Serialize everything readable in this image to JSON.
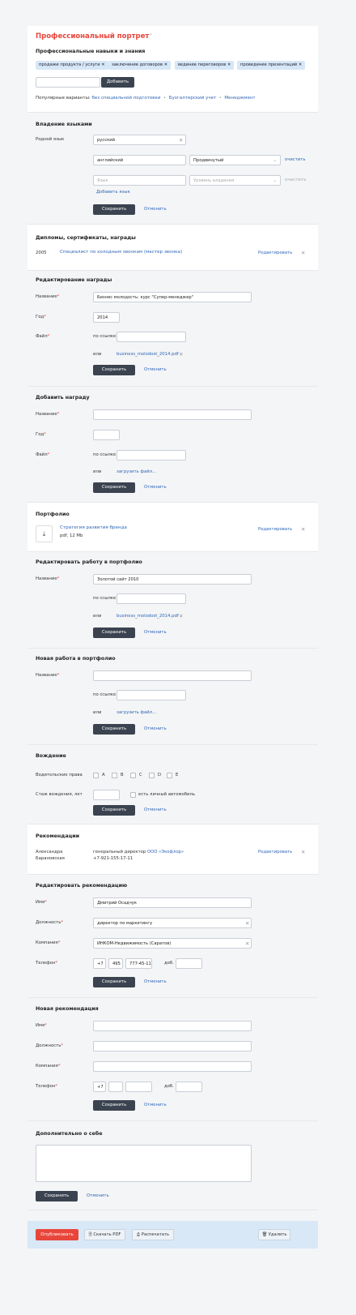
{
  "header": {
    "title": "Профессиональный портрет",
    "collapse_icon": "chevron-up-icon"
  },
  "skills": {
    "heading": "Профессиональные навыки и знания",
    "tags": [
      "продажи продукта / услуги",
      "заключение договоров",
      "ведение переговоров",
      "проведение презентаций"
    ],
    "add_button": "Добавить",
    "popular_label": "Популярные варианты:",
    "popular": [
      "без специальной подготовки",
      "Бухгалтерский учет",
      "Менеджмент"
    ]
  },
  "languages": {
    "heading": "Владение языками",
    "native_label": "Родной язык",
    "native_value": "русский",
    "lang2_value": "английский",
    "lang2_level": "Продвинутый",
    "clear": "очистить",
    "lang_placeholder": "Язык",
    "level_placeholder": "Уровень владения",
    "add_link": "Добавить язык",
    "save": "Сохранить",
    "cancel": "Отменить"
  },
  "diplomas": {
    "heading": "Диплом­ы, сертификаты, награды",
    "year": "2005",
    "title": "Специалист по холодным звонкам (мастер звонка)",
    "edit": "Редактировать"
  },
  "edit_award": {
    "heading": "Редактирование награды",
    "name_label": "Название",
    "name_value": "Бизнес молодость: курс \"Супер-менеджер\"",
    "year_label": "Год",
    "year_value": "2014",
    "file_label": "Файл",
    "by_link": "по ссылке",
    "or": "или",
    "file_name": "business_molodost_2014.pdf",
    "save": "Сохранить",
    "cancel": "Отменить"
  },
  "add_award": {
    "heading": "Добавить награду",
    "name_label": "Название",
    "year_label": "Год",
    "file_label": "Файл",
    "by_link": "по ссылке",
    "or": "или",
    "upload": "загрузить файл...",
    "save": "Сохранить",
    "cancel": "Отменить"
  },
  "portfolio": {
    "heading": "Портфолио",
    "item_title": "Стратегия развития бренда",
    "item_meta": "pdf, 12 Mb",
    "edit": "Редактировать"
  },
  "edit_portfolio": {
    "heading": "Редактировать работу в портфолио",
    "name_label": "Название",
    "name_value": "Золотой сайт 2010",
    "by_link": "по ссылке",
    "or": "или",
    "file_name": "business_molodost_2014.pdf",
    "save": "Сохранить",
    "cancel": "Отменить"
  },
  "new_portfolio": {
    "heading": "Новая работа в портфолио",
    "name_label": "Название",
    "by_link": "по ссылке",
    "or": "или",
    "upload": "загрузить файл...",
    "save": "Сохранить",
    "cancel": "Отменить"
  },
  "driving": {
    "heading": "Вождение",
    "license_label": "Водительские права",
    "categories": [
      "A",
      "B",
      "C",
      "D",
      "E"
    ],
    "exp_label": "Стаж вождения, лет",
    "own_car": "есть личный автомобиль",
    "save": "Сохранить",
    "cancel": "Отменить"
  },
  "recommendations": {
    "heading": "Рекомендации",
    "name_line1": "Александра",
    "name_line2": "Барановская",
    "position": "генеральный директор",
    "company": "ООО «Экофлор»",
    "phone": "+7-921-155-17-11",
    "edit": "Редактировать"
  },
  "edit_rec": {
    "heading": "Редактировать рекомендацию",
    "name_label": "Имя",
    "name_value": "Дмитрий Осадчук",
    "pos_label": "Должность",
    "pos_value": "директор по маркетингу",
    "company_label": "Компания",
    "company_value": "ИНКОМ-Недвижимость (Саратов)",
    "phone_label": "Телефон",
    "phone_code": "+7",
    "phone_area": "495",
    "phone_num": "777-45-11",
    "ext_label": "доб.",
    "save": "Сохранить",
    "cancel": "Отменить"
  },
  "new_rec": {
    "heading": "Новая рекомендация",
    "name_label": "Имя",
    "pos_label": "Должность",
    "company_label": "Компания",
    "phone_label": "Телефон",
    "phone_code": "+7",
    "ext_label": "доб.",
    "save": "Сохранить",
    "cancel": "Отменить"
  },
  "about": {
    "heading": "Дополнительно о себе",
    "save": "Сохранить",
    "cancel": "Отменить"
  },
  "footer": {
    "publish": "Опубликовать",
    "pdf": "Скачать PDF",
    "print": "Распечатать",
    "delete": "Удалить"
  },
  "colors": {
    "accent": "#e8463b",
    "link": "#2f66b6",
    "button": "#3b4350",
    "tag": "#d6e7f7"
  }
}
